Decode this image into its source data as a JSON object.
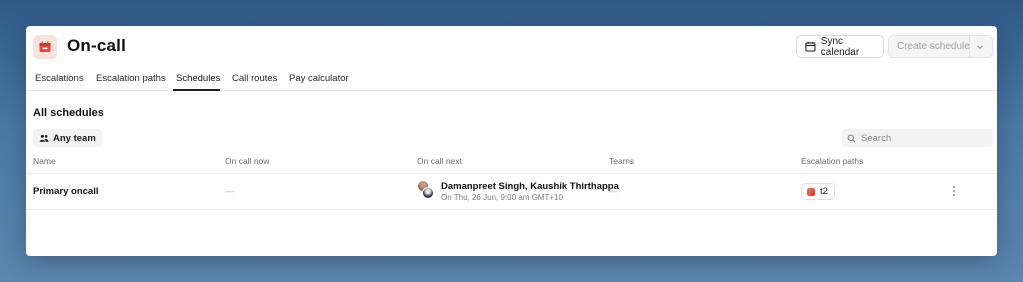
{
  "app": {
    "title": "On-call",
    "accent_color": "#e8483a",
    "icon": "calendar-alert-icon"
  },
  "toolbar": {
    "sync_label": "Sync calendar",
    "create_label": "Create schedule"
  },
  "tabs": [
    {
      "label": "Escalations",
      "active": false
    },
    {
      "label": "Escalation paths",
      "active": false
    },
    {
      "label": "Schedules",
      "active": true
    },
    {
      "label": "Call routes",
      "active": false
    },
    {
      "label": "Pay calculator",
      "active": false
    }
  ],
  "section": {
    "title": "All schedules",
    "team_filter_label": "Any team",
    "search_placeholder": "Search"
  },
  "table": {
    "columns": [
      "Name",
      "On call now",
      "On call next",
      "Teams",
      "Escalation paths"
    ],
    "rows": [
      {
        "name": "Primary oncall",
        "on_call_now": "—",
        "on_call_next_names": "Damanpreet Singh, Kaushik Thirthappa",
        "on_call_next_time": "On Thu, 26 Jun, 9:00 am GMT+10",
        "teams": "—",
        "escalation_path": "t2"
      }
    ]
  }
}
